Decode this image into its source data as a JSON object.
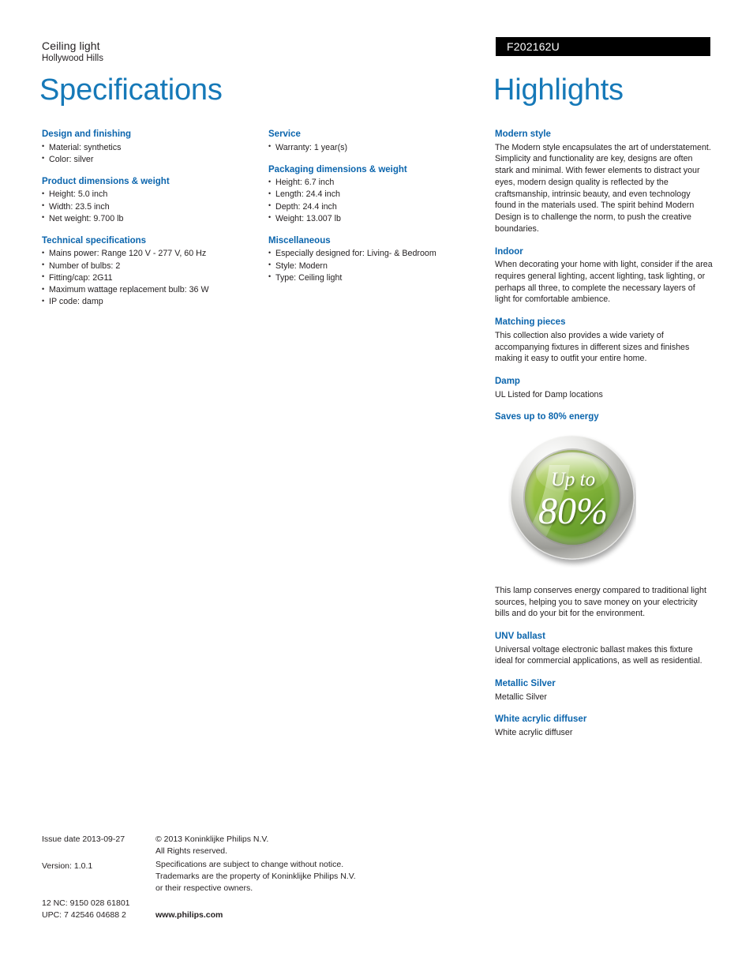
{
  "header": {
    "product_type": "Ceiling light",
    "product_name": "Hollywood Hills",
    "product_code": "F202162U",
    "title_left": "Specifications",
    "title_right": "Highlights"
  },
  "colors": {
    "heading_blue": "#1679b8",
    "section_blue": "#0b65ad",
    "banner_black": "#000000",
    "body_text": "#231f20",
    "badge_green": "#7fb335"
  },
  "spec_column_1": [
    {
      "title": "Design and finishing",
      "items": [
        "Material: synthetics",
        "Color: silver"
      ]
    },
    {
      "title": "Product dimensions & weight",
      "items": [
        "Height: 5.0 inch",
        "Width: 23.5 inch",
        "Net weight: 9.700 lb"
      ]
    },
    {
      "title": "Technical specifications",
      "items": [
        "Mains power: Range 120 V - 277 V, 60 Hz",
        "Number of bulbs: 2",
        "Fitting/cap: 2G11",
        "Maximum wattage replacement bulb: 36 W",
        "IP code: damp"
      ]
    }
  ],
  "spec_column_2": [
    {
      "title": "Service",
      "items": [
        "Warranty: 1 year(s)"
      ]
    },
    {
      "title": "Packaging dimensions & weight",
      "items": [
        "Height: 6.7 inch",
        "Length: 24.4 inch",
        "Depth: 24.4 inch",
        "Weight: 13.007 lb"
      ]
    },
    {
      "title": "Miscellaneous",
      "items": [
        "Especially designed for: Living- & Bedroom",
        "Style: Modern",
        "Type: Ceiling light"
      ]
    }
  ],
  "highlights": {
    "modern_style": {
      "title": "Modern style",
      "body": "The Modern style encapsulates the art of understatement. Simplicity and functionality are key, designs are often stark and minimal. With fewer elements to distract your eyes, modern design quality is reflected by the craftsmanship, intrinsic beauty, and even technology found in the materials used. The spirit behind Modern Design is to challenge the norm, to push the creative boundaries."
    },
    "indoor": {
      "title": "Indoor",
      "body": "When decorating your home with light, consider if the area requires general lighting, accent lighting, task lighting, or perhaps all three, to complete the necessary layers of light for comfortable ambience."
    },
    "matching_pieces": {
      "title": "Matching pieces",
      "body": "This collection also provides a wide variety of accompanying fixtures in different sizes and finishes making it easy to outfit your entire home."
    },
    "damp": {
      "title": "Damp",
      "body": "UL Listed for Damp locations"
    },
    "saves_energy": {
      "title": "Saves up to 80% energy",
      "badge_line_1": "Up to",
      "badge_line_2": "80%",
      "body": "This lamp conserves energy compared to traditional light sources, helping you to save money on your electricity bills and do your bit for the environment."
    },
    "unv_ballast": {
      "title": "UNV ballast",
      "body": "Universal voltage electronic ballast makes this fixture ideal for commercial applications, as well as residential."
    },
    "metallic_silver": {
      "title": "Metallic Silver",
      "body": "Metallic Silver"
    },
    "white_acrylic_diffuser": {
      "title": "White acrylic diffuser",
      "body": "White acrylic diffuser"
    }
  },
  "footer": {
    "issue_date": "Issue date 2013-09-27",
    "version": "Version: 1.0.1",
    "nc_code": "12 NC: 9150 028 61801",
    "upc_code": "UPC: 7 42546 04688 2",
    "copyright_line_1": "© 2013 Koninklijke Philips N.V.",
    "copyright_line_2": "All Rights reserved.",
    "legal_line_1": "Specifications are subject to change without notice.",
    "legal_line_2": "Trademarks are the property of Koninklijke Philips N.V.",
    "legal_line_3": "or their respective owners.",
    "website": "www.philips.com"
  }
}
